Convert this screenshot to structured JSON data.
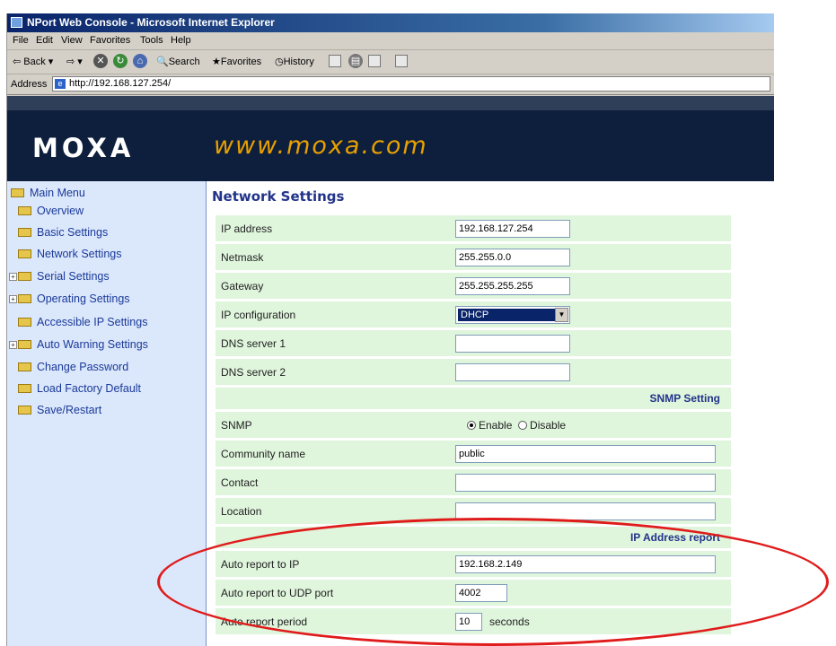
{
  "window": {
    "title": "NPort Web Console - Microsoft Internet Explorer"
  },
  "menubar": [
    "File",
    "Edit",
    "View",
    "Favorites",
    "Tools",
    "Help"
  ],
  "toolbar": {
    "back": "Back",
    "search": "Search",
    "favorites": "Favorites",
    "history": "History"
  },
  "address": {
    "label": "Address",
    "url": "http://192.168.127.254/"
  },
  "banner": {
    "logo": "MOXA",
    "site": "www.moxa.com"
  },
  "sidebar": {
    "root": "Main Menu",
    "items": [
      {
        "label": "Overview"
      },
      {
        "label": "Basic Settings"
      },
      {
        "label": "Network Settings"
      },
      {
        "label": "Serial Settings"
      },
      {
        "label": "Operating Settings"
      },
      {
        "label": "Accessible IP Settings"
      },
      {
        "label": "Auto Warning Settings"
      },
      {
        "label": "Change Password"
      },
      {
        "label": "Load Factory Default"
      },
      {
        "label": "Save/Restart"
      }
    ]
  },
  "page": {
    "title": "Network Settings"
  },
  "form": {
    "ip_address": {
      "label": "IP address",
      "value": "192.168.127.254"
    },
    "netmask": {
      "label": "Netmask",
      "value": "255.255.0.0"
    },
    "gateway": {
      "label": "Gateway",
      "value": "255.255.255.255"
    },
    "ip_config": {
      "label": "IP configuration",
      "value": "DHCP"
    },
    "dns1": {
      "label": "DNS server 1",
      "value": ""
    },
    "dns2": {
      "label": "DNS server 2",
      "value": ""
    },
    "snmp_section": "SNMP Setting",
    "snmp": {
      "label": "SNMP",
      "enable": "Enable",
      "disable": "Disable",
      "selected": "Enable"
    },
    "community": {
      "label": "Community name",
      "value": "public"
    },
    "contact": {
      "label": "Contact",
      "value": ""
    },
    "location": {
      "label": "Location",
      "value": ""
    },
    "ip_report_section": "IP Address report",
    "auto_report_ip": {
      "label": "Auto report to IP",
      "value": "192.168.2.149"
    },
    "auto_report_port": {
      "label": "Auto report to UDP port",
      "value": "4002"
    },
    "auto_report_period": {
      "label": "Auto report period",
      "value": "10",
      "unit": "seconds"
    }
  },
  "colors": {
    "highlight_circle": "#e01b1b",
    "form_row": "#dff5dc",
    "sidebar": "#dbe7fb",
    "banner": "#0d1f3c"
  }
}
